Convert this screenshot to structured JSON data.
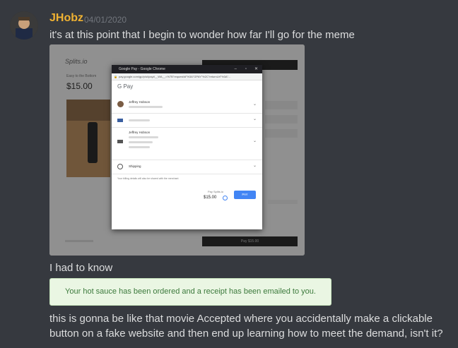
{
  "message": {
    "author": "JHobz",
    "timestamp": "04/01/2020",
    "line1": "it's at this point that I begin to wonder how far I'll go for the meme",
    "line2": "I had to know",
    "line3a": "this is gonna be like that movie Accepted where you accidentally make a clickable",
    "line3b": "button on a fake website and then end up learning how to meet the demand, isn't it?"
  },
  "screenshot1": {
    "site_logo": "Splits.io",
    "page_price": "$15.00",
    "page_small_text": "Easy to the Bottom",
    "pay_button": "Pay $15.00",
    "window_title": "Google Pay - Google Chrome",
    "url": "pay.google.com/gp/p/ui/pay#__WA__=%7B\"requestId\"%3A\"GPAY\"%2C\"returnUrl\"%3A\"...",
    "gpay_logo": "G Pay",
    "contact_name": "Jeffrey Hobson",
    "shipping_name": "Jeffrey Hobson",
    "shipping_label": "Shipping",
    "billing_note": "Your billing details will also be shared with the merchant",
    "pay_to": "Pay Splits.io",
    "amount": "$15.00",
    "gpay_pay_button": "PAY",
    "colors": {
      "gpay_blue": "#4285f4"
    }
  },
  "receipt_embed": {
    "text": "Your hot sauce has been ordered and a receipt has been emailed to you."
  }
}
